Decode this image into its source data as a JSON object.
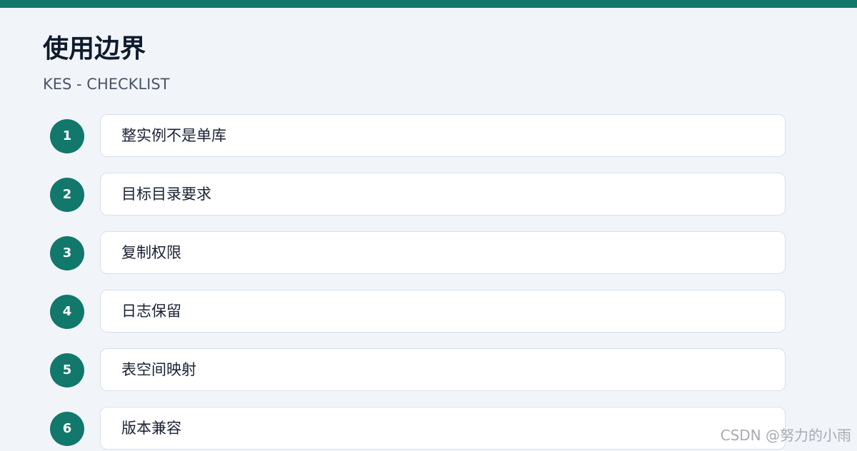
{
  "header": {
    "title": "使用边界",
    "subtitle": "KES - CHECKLIST"
  },
  "checklist": [
    {
      "number": "1",
      "label": "整实例不是单库"
    },
    {
      "number": "2",
      "label": "目标目录要求"
    },
    {
      "number": "3",
      "label": "复制权限"
    },
    {
      "number": "4",
      "label": "日志保留"
    },
    {
      "number": "5",
      "label": "表空间映射"
    },
    {
      "number": "6",
      "label": "版本兼容"
    }
  ],
  "watermark": "CSDN @努力的小雨",
  "colors": {
    "accent": "#11786b",
    "background": "#f1f4f9",
    "card": "#ffffff",
    "card_border": "#d9e0ea",
    "title": "#0f1b2d"
  }
}
